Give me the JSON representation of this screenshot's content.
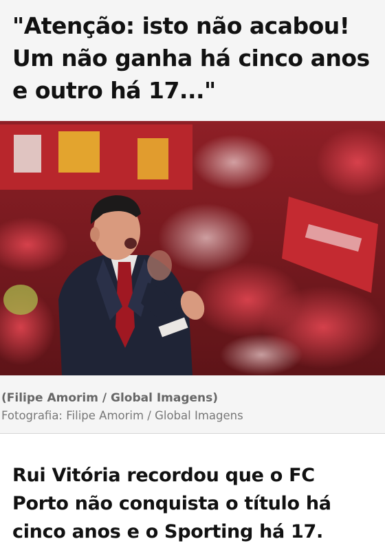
{
  "article": {
    "headline": "\"Atenção: isto não acabou! Um não ganha há cinco anos e outro há 17...\"",
    "image_alt": "Rui Vitória aplaudindo no banco com adeptos ao fundo",
    "caption_credit": "(Filipe Amorim / Global Imagens)",
    "caption_photo": "Fotografia: Filipe Amorim / Global Imagens",
    "lead": "Rui Vitória recordou que o FC Porto não conquista o título há cinco anos e o Sporting há 17."
  },
  "colors": {
    "background": "#f5f5f5",
    "crowd_red": "#b3222b",
    "text_dark": "#111111",
    "caption_grey": "#666666"
  }
}
